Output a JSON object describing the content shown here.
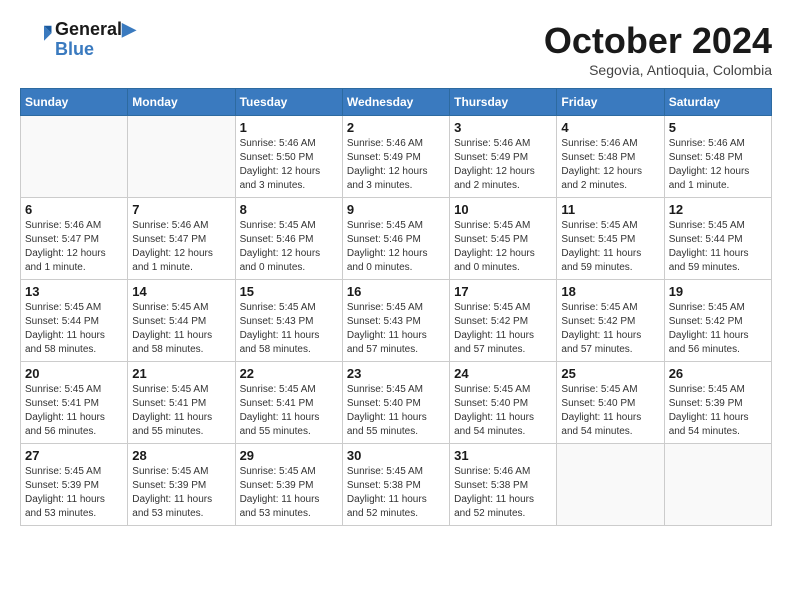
{
  "logo": {
    "line1": "General",
    "line2": "Blue"
  },
  "title": "October 2024",
  "subtitle": "Segovia, Antioquia, Colombia",
  "weekdays": [
    "Sunday",
    "Monday",
    "Tuesday",
    "Wednesday",
    "Thursday",
    "Friday",
    "Saturday"
  ],
  "weeks": [
    [
      {
        "day": "",
        "info": ""
      },
      {
        "day": "",
        "info": ""
      },
      {
        "day": "1",
        "info": "Sunrise: 5:46 AM\nSunset: 5:50 PM\nDaylight: 12 hours and 3 minutes."
      },
      {
        "day": "2",
        "info": "Sunrise: 5:46 AM\nSunset: 5:49 PM\nDaylight: 12 hours and 3 minutes."
      },
      {
        "day": "3",
        "info": "Sunrise: 5:46 AM\nSunset: 5:49 PM\nDaylight: 12 hours and 2 minutes."
      },
      {
        "day": "4",
        "info": "Sunrise: 5:46 AM\nSunset: 5:48 PM\nDaylight: 12 hours and 2 minutes."
      },
      {
        "day": "5",
        "info": "Sunrise: 5:46 AM\nSunset: 5:48 PM\nDaylight: 12 hours and 1 minute."
      }
    ],
    [
      {
        "day": "6",
        "info": "Sunrise: 5:46 AM\nSunset: 5:47 PM\nDaylight: 12 hours and 1 minute."
      },
      {
        "day": "7",
        "info": "Sunrise: 5:46 AM\nSunset: 5:47 PM\nDaylight: 12 hours and 1 minute."
      },
      {
        "day": "8",
        "info": "Sunrise: 5:45 AM\nSunset: 5:46 PM\nDaylight: 12 hours and 0 minutes."
      },
      {
        "day": "9",
        "info": "Sunrise: 5:45 AM\nSunset: 5:46 PM\nDaylight: 12 hours and 0 minutes."
      },
      {
        "day": "10",
        "info": "Sunrise: 5:45 AM\nSunset: 5:45 PM\nDaylight: 12 hours and 0 minutes."
      },
      {
        "day": "11",
        "info": "Sunrise: 5:45 AM\nSunset: 5:45 PM\nDaylight: 11 hours and 59 minutes."
      },
      {
        "day": "12",
        "info": "Sunrise: 5:45 AM\nSunset: 5:44 PM\nDaylight: 11 hours and 59 minutes."
      }
    ],
    [
      {
        "day": "13",
        "info": "Sunrise: 5:45 AM\nSunset: 5:44 PM\nDaylight: 11 hours and 58 minutes."
      },
      {
        "day": "14",
        "info": "Sunrise: 5:45 AM\nSunset: 5:44 PM\nDaylight: 11 hours and 58 minutes."
      },
      {
        "day": "15",
        "info": "Sunrise: 5:45 AM\nSunset: 5:43 PM\nDaylight: 11 hours and 58 minutes."
      },
      {
        "day": "16",
        "info": "Sunrise: 5:45 AM\nSunset: 5:43 PM\nDaylight: 11 hours and 57 minutes."
      },
      {
        "day": "17",
        "info": "Sunrise: 5:45 AM\nSunset: 5:42 PM\nDaylight: 11 hours and 57 minutes."
      },
      {
        "day": "18",
        "info": "Sunrise: 5:45 AM\nSunset: 5:42 PM\nDaylight: 11 hours and 57 minutes."
      },
      {
        "day": "19",
        "info": "Sunrise: 5:45 AM\nSunset: 5:42 PM\nDaylight: 11 hours and 56 minutes."
      }
    ],
    [
      {
        "day": "20",
        "info": "Sunrise: 5:45 AM\nSunset: 5:41 PM\nDaylight: 11 hours and 56 minutes."
      },
      {
        "day": "21",
        "info": "Sunrise: 5:45 AM\nSunset: 5:41 PM\nDaylight: 11 hours and 55 minutes."
      },
      {
        "day": "22",
        "info": "Sunrise: 5:45 AM\nSunset: 5:41 PM\nDaylight: 11 hours and 55 minutes."
      },
      {
        "day": "23",
        "info": "Sunrise: 5:45 AM\nSunset: 5:40 PM\nDaylight: 11 hours and 55 minutes."
      },
      {
        "day": "24",
        "info": "Sunrise: 5:45 AM\nSunset: 5:40 PM\nDaylight: 11 hours and 54 minutes."
      },
      {
        "day": "25",
        "info": "Sunrise: 5:45 AM\nSunset: 5:40 PM\nDaylight: 11 hours and 54 minutes."
      },
      {
        "day": "26",
        "info": "Sunrise: 5:45 AM\nSunset: 5:39 PM\nDaylight: 11 hours and 54 minutes."
      }
    ],
    [
      {
        "day": "27",
        "info": "Sunrise: 5:45 AM\nSunset: 5:39 PM\nDaylight: 11 hours and 53 minutes."
      },
      {
        "day": "28",
        "info": "Sunrise: 5:45 AM\nSunset: 5:39 PM\nDaylight: 11 hours and 53 minutes."
      },
      {
        "day": "29",
        "info": "Sunrise: 5:45 AM\nSunset: 5:39 PM\nDaylight: 11 hours and 53 minutes."
      },
      {
        "day": "30",
        "info": "Sunrise: 5:45 AM\nSunset: 5:38 PM\nDaylight: 11 hours and 52 minutes."
      },
      {
        "day": "31",
        "info": "Sunrise: 5:46 AM\nSunset: 5:38 PM\nDaylight: 11 hours and 52 minutes."
      },
      {
        "day": "",
        "info": ""
      },
      {
        "day": "",
        "info": ""
      }
    ]
  ]
}
